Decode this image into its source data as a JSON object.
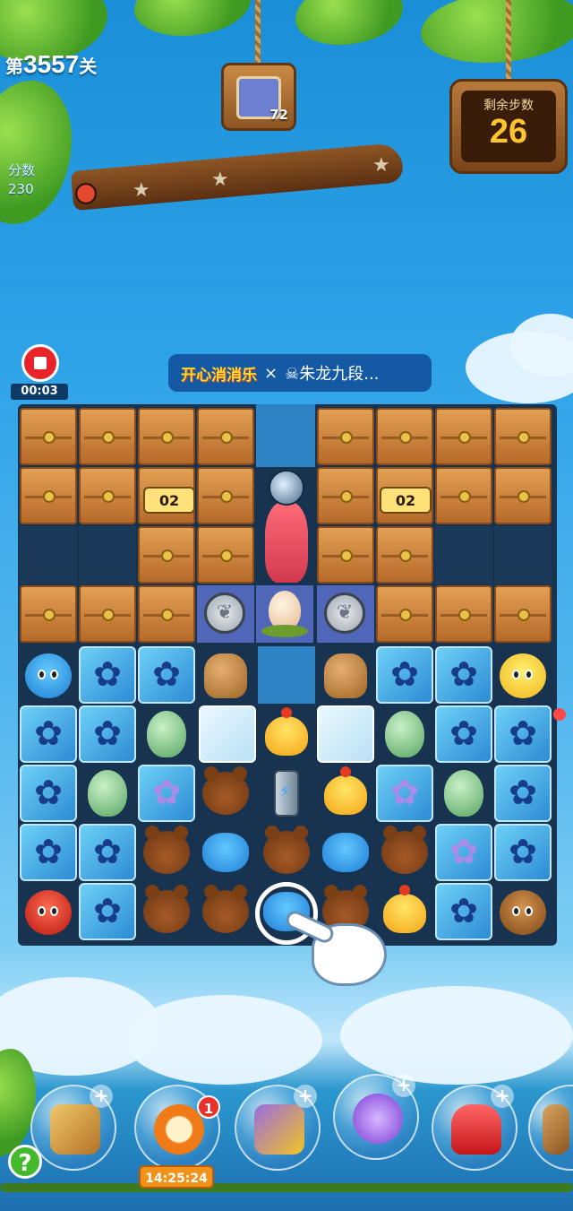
{
  "level": {
    "prefix": "第",
    "number": "3557",
    "suffix": "关"
  },
  "score": {
    "label": "分数",
    "value": "230"
  },
  "target": {
    "count": "72"
  },
  "moves": {
    "label": "剩余步数",
    "value": "26"
  },
  "recording": {
    "time": "00:03"
  },
  "banner": {
    "logo": "开心消消乐",
    "separator": "×",
    "text": "☠朱龙九段..."
  },
  "board": {
    "locks": [
      "02",
      "02"
    ]
  },
  "boosters": {
    "badge_count": "1",
    "timer": "14:25:24"
  },
  "help": {
    "label": "?"
  },
  "icons": {
    "record": "stop-record-icon",
    "help": "help-icon",
    "tap_hint": "tap-hand-icon"
  }
}
